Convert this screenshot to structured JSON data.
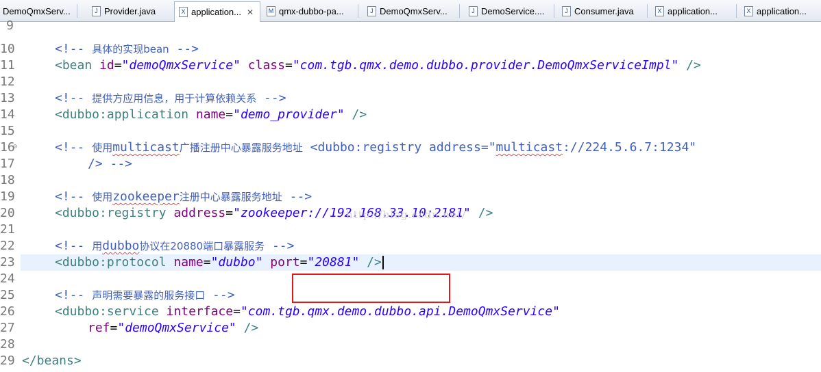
{
  "tabs": [
    {
      "label": "DemoQmxServ...",
      "icon": "java-file-icon",
      "active": false
    },
    {
      "label": "Provider.java",
      "icon": "java-file-icon",
      "active": false
    },
    {
      "label": "application...",
      "icon": "xml-file-icon",
      "active": true
    },
    {
      "label": "qmx-dubbo-pa...",
      "icon": "maven-pom-icon",
      "active": false
    },
    {
      "label": "DemoQmxServ...",
      "icon": "java-file-icon",
      "active": false
    },
    {
      "label": "DemoService....",
      "icon": "java-file-icon",
      "active": false
    },
    {
      "label": "Consumer.java",
      "icon": "java-file-icon",
      "active": false
    },
    {
      "label": "application...",
      "icon": "xml-file-icon",
      "active": false
    },
    {
      "label": "application...",
      "icon": "xml-file-icon",
      "active": false
    }
  ],
  "editor": {
    "line_numbers": [
      "9",
      "10",
      "11",
      "12",
      "13",
      "14",
      "15",
      "16",
      "17",
      "18",
      "19",
      "20",
      "21",
      "22",
      "23",
      "24",
      "25",
      "26",
      "27",
      "28",
      "29"
    ],
    "lines": [
      {
        "cm_open": "<!-- ",
        "text": "具体的实现bean",
        "cm_close": " -->"
      },
      {
        "tag": "<bean",
        "attr1": " id",
        "eq1": "=",
        "val1": "\"demoQmxService\"",
        "attr2": " class",
        "eq2": "=",
        "val2": "\"com.tgb.qmx.demo.dubbo.provider.DemoQmxServiceImpl\"",
        "end": " />"
      },
      {
        "cm_open": "<!-- ",
        "text": "提供方应用信息，用于计算依赖关系",
        "cm_close": " -->"
      },
      {
        "tag": "<dubbo:application",
        "attr1": " name",
        "eq1": "=",
        "val1": "\"demo_provider\"",
        "end": " />"
      },
      {
        "cm_open": "<!-- ",
        "pre": "使用",
        "word": "multicast",
        "post": "广播注册中心暴露服务地址",
        "rest": " <dubbo:registry address=\"",
        "word2": "multicast",
        "rest2": "://224.5.6.7:1234\""
      },
      {
        "cont": "/> -->"
      },
      {
        "cm_open": "<!-- ",
        "pre": "使用",
        "word": "zookeeper",
        "post": "注册中心暴露服务地址",
        "cm_close": " -->"
      },
      {
        "tag": "<dubbo:registry",
        "attr1": " address",
        "eq1": "=",
        "val1": "\"zookeeper://192.168.33.10:2181\"",
        "end": " />"
      },
      {
        "cm_open": "<!-- ",
        "pre": "用",
        "word": "dubbo",
        "post": "协议在20880端口暴露服务",
        "cm_close": " -->"
      },
      {
        "tag": "<dubbo:protocol",
        "attr1": " name",
        "eq1": "=",
        "val1": "\"dubbo\"",
        "attr2": " port",
        "eq2": "=",
        "val2": "\"20881\"",
        "end": " />"
      },
      {
        "cm_open": "<!-- ",
        "text": "声明需要暴露的服务接口",
        "cm_close": " -->"
      },
      {
        "tag": "<dubbo:service",
        "attr1": " interface",
        "eq1": "=",
        "val1": "\"com.tgb.qmx.demo.dubbo.api.DemoQmxService\""
      },
      {
        "attr1": "ref",
        "eq1": "=",
        "val1": "\"demoQmxService\"",
        "end": " />"
      },
      {
        "tag": "</beans>"
      }
    ]
  },
  "watermark": "http://blog.csdn.net/"
}
